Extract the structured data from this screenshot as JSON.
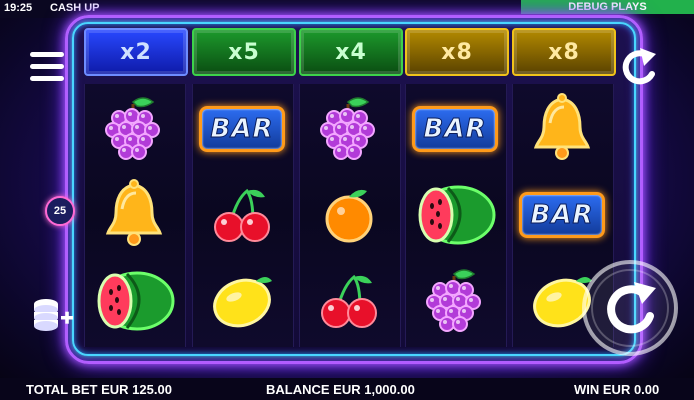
{
  "status_bar": {
    "time": "19:25",
    "game_title": "CASH UP",
    "debug_label": "DEBUG PLAYS"
  },
  "multipliers": [
    {
      "label": "x2",
      "color": "blue"
    },
    {
      "label": "x5",
      "color": "green"
    },
    {
      "label": "x4",
      "color": "green"
    },
    {
      "label": "x8",
      "color": "gold"
    },
    {
      "label": "x8",
      "color": "gold"
    }
  ],
  "reels": [
    [
      "grapes",
      "bell",
      "watermelon"
    ],
    [
      "bar",
      "cherries",
      "lemon"
    ],
    [
      "grapes",
      "orange",
      "cherries"
    ],
    [
      "bar",
      "watermelon",
      "grapes"
    ],
    [
      "bell",
      "bar",
      "lemon"
    ]
  ],
  "bar_text": "BAR",
  "controls": {
    "menu_icon": "hamburger-menu-icon",
    "lines_count": "25",
    "coins_icon": "coin-stack-plus-icon",
    "undo_icon": "circular-arrow-icon",
    "spin_icon": "spin-arrow-icon"
  },
  "bottom_bar": {
    "total_bet": "TOTAL BET EUR 125.00",
    "balance": "BALANCE EUR 1,000.00",
    "win": "WIN EUR 0.00"
  },
  "colors": {
    "debug_bg": "#22b14c",
    "frame_purple": "#b45cff",
    "frame_cyan": "#49d6ff"
  }
}
